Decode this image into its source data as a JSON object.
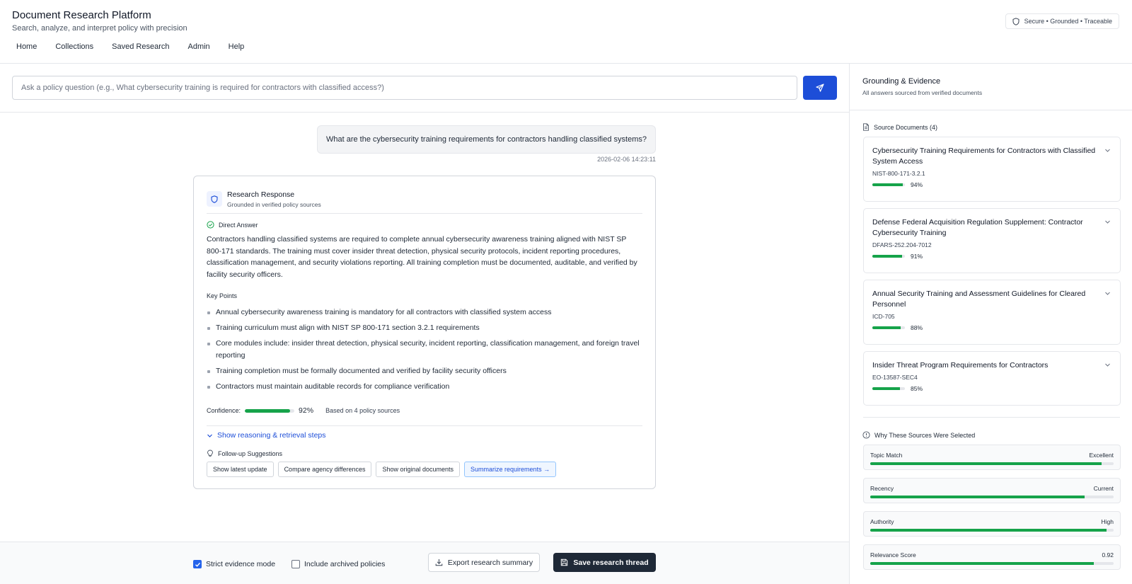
{
  "header": {
    "title": "Document Research Platform",
    "subtitle": "Search, analyze, and interpret policy with precision",
    "badge": "Secure • Grounded • Traceable",
    "nav": [
      "Home",
      "Collections",
      "Saved Research",
      "Admin",
      "Help"
    ]
  },
  "search": {
    "placeholder": "Ask a policy question (e.g., What cybersecurity training is required for contractors with classified access?)",
    "value": ""
  },
  "conversation": {
    "user_message": "What are the cybersecurity training requirements for contractors handling classified systems?",
    "timestamp": "2026-02-06 14:23:11"
  },
  "response": {
    "title": "Research Response",
    "subtitle": "Grounded in verified policy sources",
    "direct_answer_label": "Direct Answer",
    "direct_answer": "Contractors handling classified systems are required to complete annual cybersecurity awareness training aligned with NIST SP 800-171 standards. The training must cover insider threat detection, physical security protocols, incident reporting procedures, classification management, and security violations reporting. All training completion must be documented, auditable, and verified by facility security officers.",
    "key_points_label": "Key Points",
    "key_points": [
      "Annual cybersecurity awareness training is mandatory for all contractors with classified system access",
      "Training curriculum must align with NIST SP 800-171 section 3.2.1 requirements",
      "Core modules include: insider threat detection, physical security, incident reporting, classification management, and foreign travel reporting",
      "Training completion must be formally documented and verified by facility security officers",
      "Contractors must maintain auditable records for compliance verification"
    ],
    "confidence_label": "Confidence:",
    "confidence_value": "92%",
    "confidence_fraction": 0.92,
    "sources_note": "Based on 4 policy sources",
    "reasoning_link": "Show reasoning & retrieval steps",
    "followup_label": "Follow-up Suggestions",
    "followups": [
      "Show latest update",
      "Compare agency differences",
      "Show original documents",
      "Summarize requirements →"
    ]
  },
  "footer": {
    "strict_mode_label": "Strict evidence mode",
    "strict_mode_checked": true,
    "archived_label": "Include archived policies",
    "archived_checked": false,
    "export_label": "Export research summary",
    "save_label": "Save research thread"
  },
  "panel": {
    "title": "Grounding & Evidence",
    "subtitle": "All answers sourced from verified documents",
    "sources_label": "Source Documents (4)",
    "sources": [
      {
        "title": "Cybersecurity Training Requirements for Contractors with Classified System Access",
        "id": "NIST-800-171-3.2.1",
        "score": "94%",
        "fraction": 0.94
      },
      {
        "title": "Defense Federal Acquisition Regulation Supplement: Contractor Cybersecurity Training",
        "id": "DFARS-252.204-7012",
        "score": "91%",
        "fraction": 0.91
      },
      {
        "title": "Annual Security Training and Assessment Guidelines for Cleared Personnel",
        "id": "ICD-705",
        "score": "88%",
        "fraction": 0.88
      },
      {
        "title": "Insider Threat Program Requirements for Contractors",
        "id": "EO-13587-SEC4",
        "score": "85%",
        "fraction": 0.85
      }
    ],
    "why_label": "Why These Sources Were Selected",
    "metrics": [
      {
        "name": "Topic Match",
        "value": "Excellent",
        "fraction": 0.95
      },
      {
        "name": "Recency",
        "value": "Current",
        "fraction": 0.88
      },
      {
        "name": "Authority",
        "value": "High",
        "fraction": 0.97
      },
      {
        "name": "Relevance Score",
        "value": "0.92",
        "fraction": 0.92
      }
    ]
  },
  "colors": {
    "accent": "#1d4ed8",
    "success": "#16a34a",
    "dark_button": "#1f2937"
  }
}
